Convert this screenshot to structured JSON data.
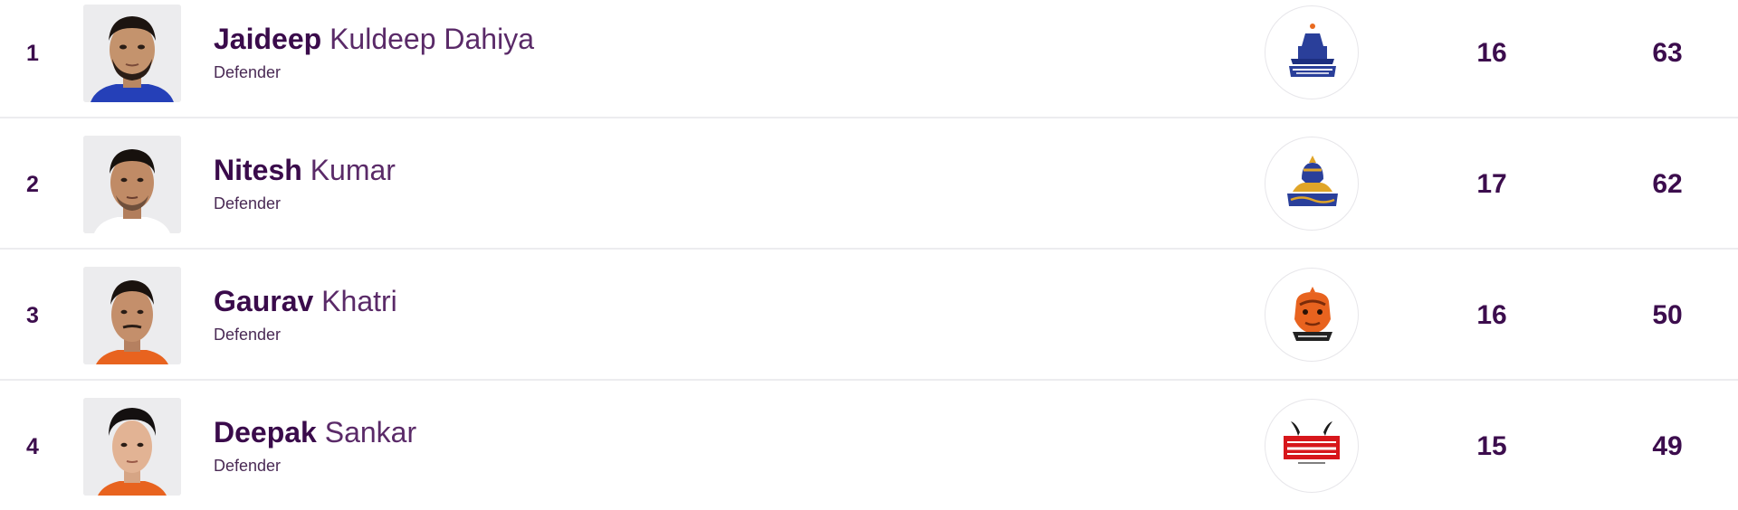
{
  "leaderboard": {
    "rows": [
      {
        "rank": "1",
        "first_name": "Jaideep",
        "last_name": "Kuldeep Dahiya",
        "position": "Defender",
        "team_logo_icon": "haryana-steelers-logo-icon",
        "matches": "16",
        "points": "63"
      },
      {
        "rank": "2",
        "first_name": "Nitesh",
        "last_name": "Kumar",
        "position": "Defender",
        "team_logo_icon": "tamil-thalaivas-logo-icon",
        "matches": "17",
        "points": "62"
      },
      {
        "rank": "3",
        "first_name": "Gaurav",
        "last_name": "Khatri",
        "position": "Defender",
        "team_logo_icon": "puneri-paltan-logo-icon",
        "matches": "16",
        "points": "50"
      },
      {
        "rank": "4",
        "first_name": "Deepak",
        "last_name": "Sankar",
        "position": "Defender",
        "team_logo_icon": "bengaluru-bulls-logo-icon",
        "matches": "15",
        "points": "49"
      }
    ]
  },
  "colors": {
    "text_primary": "#3c0d4d",
    "divider": "#ececef",
    "jersey_blue": "#2540b8",
    "jersey_orange": "#e8631f",
    "bulls_red": "#d7161b"
  }
}
